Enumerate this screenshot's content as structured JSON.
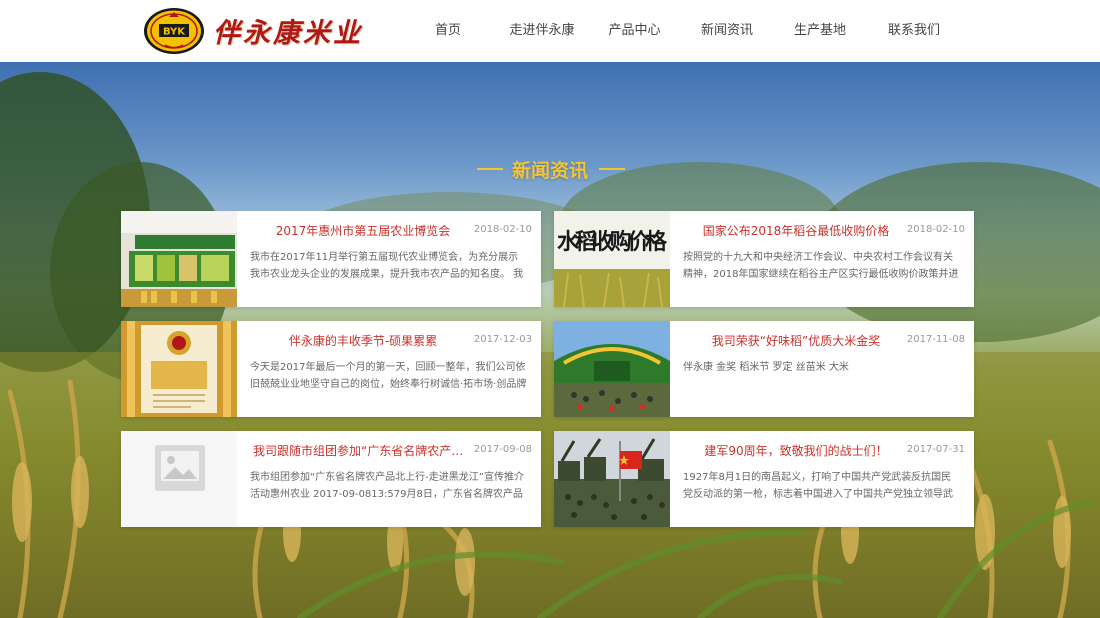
{
  "header": {
    "logo_text": "伴永康米业",
    "logo_badge_text": "BYK"
  },
  "nav": [
    {
      "label": "首页"
    },
    {
      "label": "走进伴永康"
    },
    {
      "label": "产品中心"
    },
    {
      "label": "新闻资讯"
    },
    {
      "label": "生产基地"
    },
    {
      "label": "联系我们"
    }
  ],
  "section": {
    "title": "新闻资讯"
  },
  "news": [
    {
      "title": "2017年惠州市第五届农业博览会",
      "date": "2018-02-10",
      "summary": "我市在2017年11月举行第五届现代农业博览会，为充分展示我市农业龙头企业的发展成果，提升我市农产品的知名度。 我司惠...",
      "thumb": "expo-booth-image"
    },
    {
      "title": "国家公布2018年稻谷最低收购价格",
      "date": "2018-02-10",
      "summary": "按照党的十九大和中央经济工作会议、中央农村工作会议有关精神，2018年国家继续在稻谷主产区实行最低收购价政策并进一...",
      "thumb": "rice-price-image",
      "thumb_text": "水稻收购价格"
    },
    {
      "title": "伴永康的丰收季节-硕果累累",
      "date": "2017-12-03",
      "summary": "今天是2017年最后一个月的第一天，回顾一整年，我们公司依旧兢兢业业地坚守自己的岗位，始终奉行树诚信·拓市场·创品牌·助...",
      "thumb": "award-certificate-image"
    },
    {
      "title": "我司荣获“好味稻”优质大米金奖",
      "date": "2017-11-08",
      "summary": "伴永康 金奖 稻米节 罗定 丝苗米 大米",
      "thumb": "rice-festival-image"
    },
    {
      "title": "我司跟随市组团参加“广东省名牌农产品...",
      "date": "2017-09-08",
      "summary": "我市组团参加“广东省名牌农产品北上行-走进黑龙江”宣传推介活动惠州农业 2017-09-0813:579月8日，广东省名牌农产品北...",
      "thumb": "placeholder-image"
    },
    {
      "title": "建军90周年，致敬我们的战士们！",
      "date": "2017-07-31",
      "summary": "1927年8月1日的南昌起义，打响了中国共产党武装反抗国民党反动派的第一枪，标志着中国进入了中国共产党独立领导武装革...",
      "thumb": "military-parade-image"
    }
  ],
  "colors": {
    "accent_gold": "#f4c437",
    "title_red": "#c8322b",
    "logo_red": "#b01818"
  }
}
